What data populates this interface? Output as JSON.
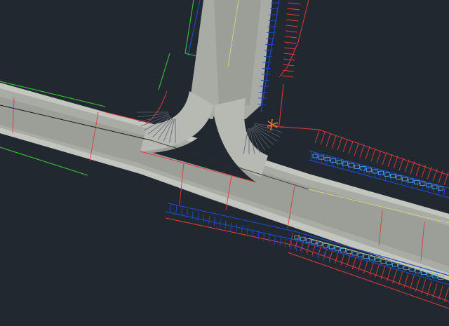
{
  "app": {
    "view": "cad-drawing-canvas"
  },
  "colors": {
    "background": "#212830",
    "road_surface": "#a9aca5",
    "road_lane": "#9c9f98",
    "road_edge": "#c9ccc4",
    "red_line": "#e23a3a",
    "blue_line": "#1f47c8",
    "light_blue_line": "#4fa3e6",
    "green_line": "#39c436",
    "yellow_line": "#d8d27a",
    "black_line": "#1a1a1a"
  },
  "layers": [
    {
      "name": "road-surface",
      "color": "road_surface"
    },
    {
      "name": "curb-lines",
      "color": "red_line"
    },
    {
      "name": "sidewalk-hatch",
      "color": "blue_line"
    },
    {
      "name": "parcel-lines",
      "color": "green_line"
    },
    {
      "name": "centerline",
      "color": "yellow_line"
    }
  ]
}
